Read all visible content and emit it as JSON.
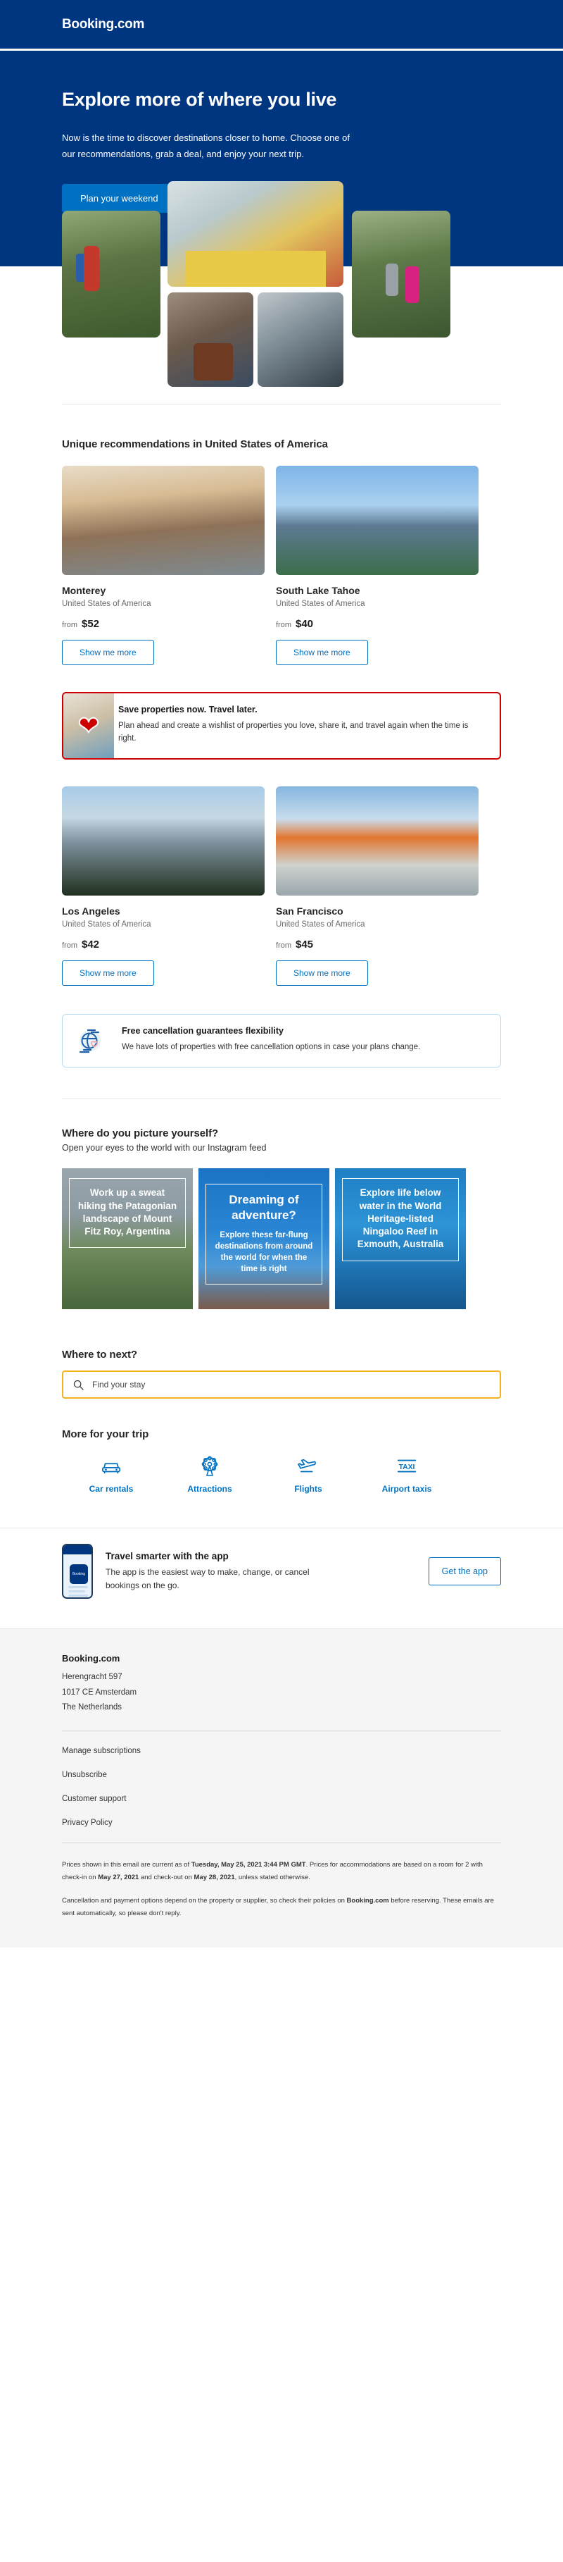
{
  "brand": {
    "name": "Booking.com"
  },
  "hero": {
    "title": "Explore more of where you live",
    "subtitle": "Now is the time to discover destinations closer to home. Choose one of our recommendations, grab a deal, and enjoy your next trip.",
    "cta": "Plan your weekend",
    "bg_color": "#003580",
    "cta_color": "#0071c2"
  },
  "recommendations": {
    "title": "Unique recommendations in United States of America",
    "from_label": "from",
    "button_label": "Show me more",
    "destinations": [
      {
        "name": "Monterey",
        "country": "United States of America",
        "price": "$52"
      },
      {
        "name": "South Lake Tahoe",
        "country": "United States of America",
        "price": "$40"
      },
      {
        "name": "Los Angeles",
        "country": "United States of America",
        "price": "$42"
      },
      {
        "name": "San Francisco",
        "country": "United States of America",
        "price": "$45"
      }
    ]
  },
  "promo_wishlist": {
    "title": "Save properties now. Travel later.",
    "text": "Plan ahead and create a wishlist of properties you love, share it, and travel again when the time is right.",
    "border_color": "#cc0000",
    "icon": "heart-icon"
  },
  "promo_cancellation": {
    "title": "Free cancellation guarantees flexibility",
    "text": "We have lots of properties with free cancellation options in case your plans change.",
    "border_color": "#b9dcf2",
    "icon": "globe-heart-icon"
  },
  "instagram": {
    "title": "Where do you picture yourself?",
    "subtitle": "Open your eyes to the world with our Instagram feed",
    "cards": [
      {
        "heading": "Work up a sweat hiking the Patagonian landscape of  Mount Fitz Roy, Argentina",
        "body": ""
      },
      {
        "heading": "Dreaming of adventure?",
        "body": "Explore these far-flung destinations from around the world for when the time is right"
      },
      {
        "heading": "Explore life below water in the World Heritage-listed Ningaloo Reef in Exmouth, Australia",
        "body": ""
      }
    ]
  },
  "search": {
    "title": "Where to next?",
    "placeholder": "Find your stay",
    "icon": "search-icon",
    "border_color": "#f5b120"
  },
  "more_trip": {
    "title": "More for your trip",
    "items": [
      {
        "label": "Car rentals",
        "icon": "car-icon"
      },
      {
        "label": "Attractions",
        "icon": "ferris-wheel-icon"
      },
      {
        "label": "Flights",
        "icon": "airplane-icon"
      },
      {
        "label": "Airport taxis",
        "icon": "taxi-icon"
      }
    ],
    "link_color": "#0071c2"
  },
  "app_promo": {
    "title": "Travel smarter with the app",
    "text": "The app is the easiest way to make, change, or cancel bookings on the go.",
    "button": "Get the app",
    "phone_label": "Booking"
  },
  "footer": {
    "brand": "Booking.com",
    "address_line1": "Herengracht 597",
    "address_line2": "1017 CE Amsterdam",
    "address_line3": "The Netherlands",
    "links": [
      "Manage subscriptions",
      "Unsubscribe",
      "Customer support",
      "Privacy Policy"
    ],
    "fine_print_1_a": "Prices shown in this email are current as of ",
    "fine_print_1_b": "Tuesday, May 25, 2021 3:44 PM GMT",
    "fine_print_1_c": ". Prices for accommodations are based on a room for 2 with check-in on ",
    "fine_print_1_d": "May 27, 2021",
    "fine_print_1_e": " and check-out on ",
    "fine_print_1_f": "May 28, 2021",
    "fine_print_1_g": ", unless stated otherwise.",
    "fine_print_2_a": "Cancellation and payment options depend on the property or supplier, so check their policies on ",
    "fine_print_2_b": "Booking.com",
    "fine_print_2_c": " before reserving. These emails are sent automatically, so please don't reply."
  }
}
